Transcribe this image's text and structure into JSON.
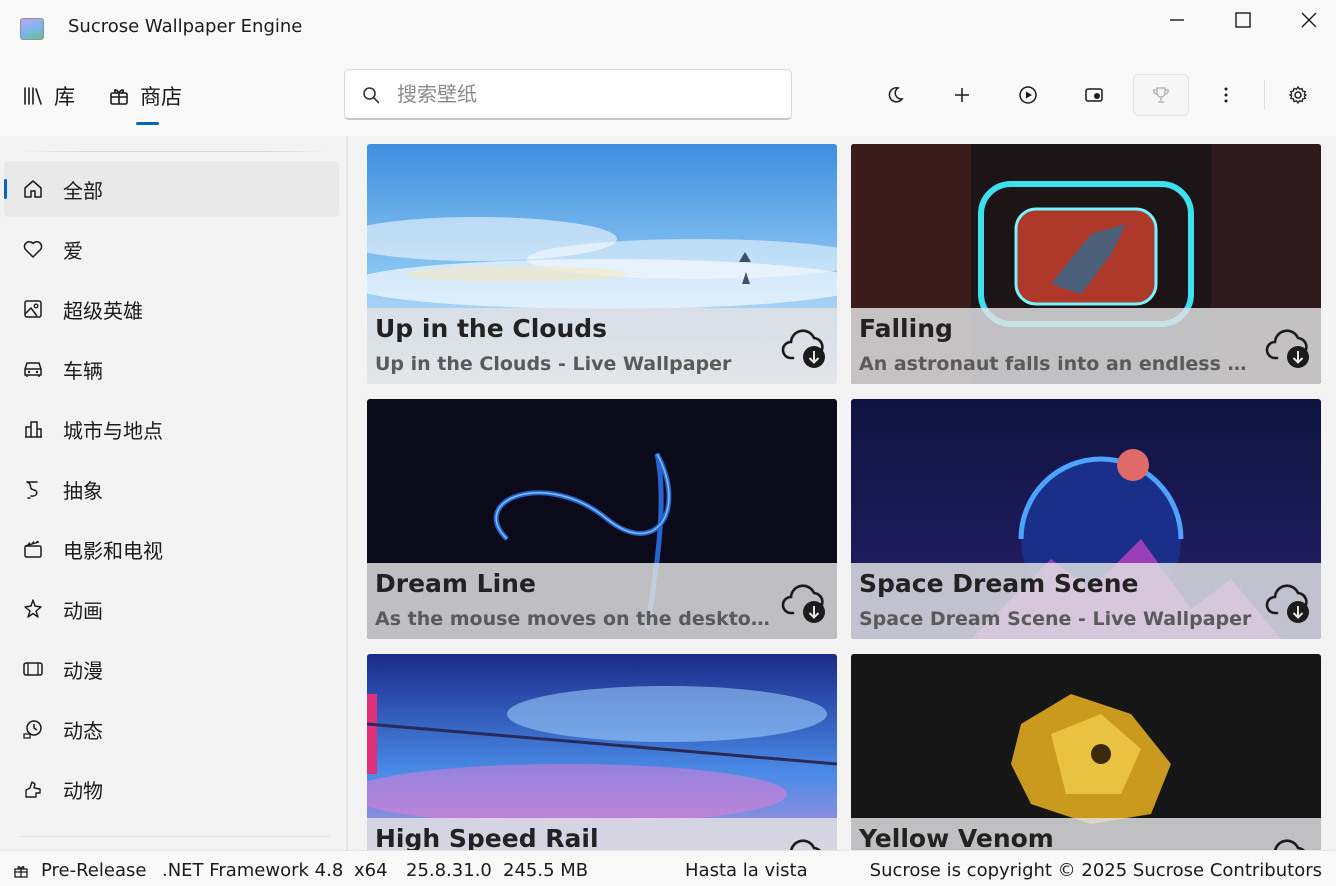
{
  "window": {
    "title": "Sucrose Wallpaper Engine"
  },
  "nav": {
    "library_label": "库",
    "store_label": "商店"
  },
  "search": {
    "placeholder": "搜索壁纸"
  },
  "toolbar": {
    "icons": [
      "moon-icon",
      "plus-icon",
      "play-circle-icon",
      "display-icon",
      "trophy-icon",
      "more-icon",
      "settings-icon"
    ]
  },
  "sidebar": {
    "items": [
      {
        "label": "全部",
        "icon": "home-icon"
      },
      {
        "label": "爱",
        "icon": "heart-icon"
      },
      {
        "label": "超级英雄",
        "icon": "image-icon"
      },
      {
        "label": "车辆",
        "icon": "car-icon"
      },
      {
        "label": "城市与地点",
        "icon": "city-icon"
      },
      {
        "label": "抽象",
        "icon": "abstract-icon"
      },
      {
        "label": "电影和电视",
        "icon": "clapperboard-icon"
      },
      {
        "label": "动画",
        "icon": "sparkle-icon"
      },
      {
        "label": "动漫",
        "icon": "film-icon"
      },
      {
        "label": "动态",
        "icon": "history-icon"
      },
      {
        "label": "动物",
        "icon": "animal-icon"
      }
    ]
  },
  "wallpapers": [
    {
      "title": "Up in the Clouds",
      "description": "Up in the Clouds - Live Wallpaper"
    },
    {
      "title": "Falling",
      "description": "An astronaut falls into an endless wormhole."
    },
    {
      "title": "Dream Line",
      "description": "As the mouse moves on the desktop, it produces a dream line."
    },
    {
      "title": "Space Dream Scene",
      "description": "Space Dream Scene - Live Wallpaper"
    },
    {
      "title": "High Speed Rail",
      "description": ""
    },
    {
      "title": "Yellow Venom",
      "description": ""
    }
  ],
  "status": {
    "release": "Pre-Release",
    "framework": ".NET Framework 4.8",
    "arch": "x64",
    "version": "25.8.31.0",
    "memory": "245.5 MB",
    "message": "Hasta la vista",
    "copyright": "Sucrose is copyright © 2025 Sucrose Contributors"
  },
  "colors": {
    "accent": "#0067c0"
  }
}
